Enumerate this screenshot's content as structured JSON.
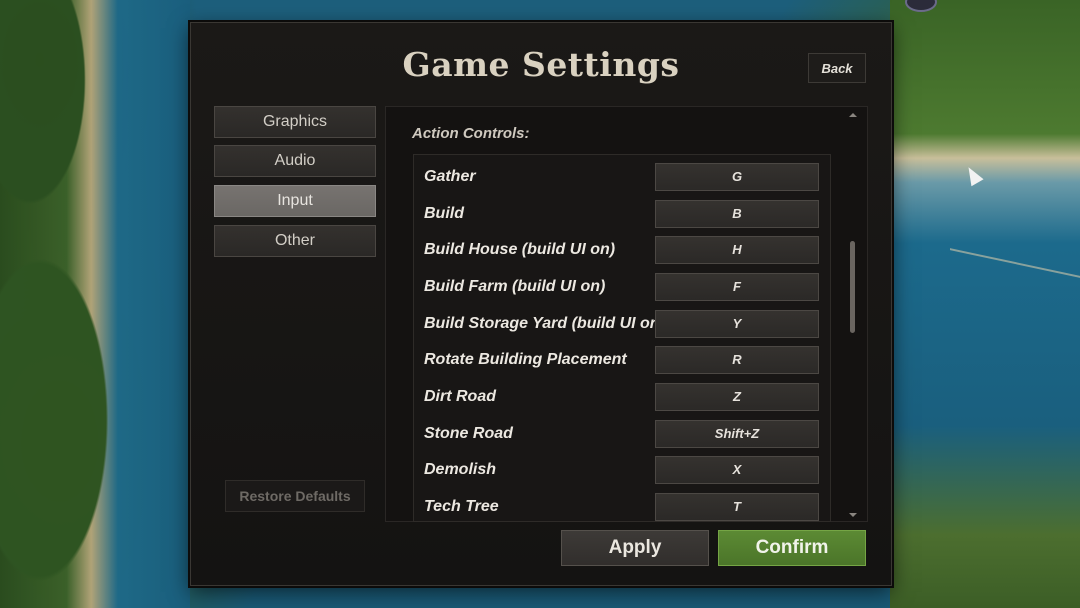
{
  "window": {
    "title": "Game Settings",
    "back_label": "Back"
  },
  "sidebar": {
    "items": [
      {
        "label": "Graphics",
        "active": false
      },
      {
        "label": "Audio",
        "active": false
      },
      {
        "label": "Input",
        "active": true
      },
      {
        "label": "Other",
        "active": false
      }
    ],
    "restore_label": "Restore Defaults"
  },
  "content": {
    "section_title": "Action Controls:",
    "bindings": [
      {
        "action": "Gather",
        "key": "G"
      },
      {
        "action": "Build",
        "key": "B"
      },
      {
        "action": "Build House (build UI on)",
        "key": "H"
      },
      {
        "action": "Build Farm (build UI on)",
        "key": "F"
      },
      {
        "action": "Build Storage Yard (build UI on)",
        "key": "Y"
      },
      {
        "action": "Rotate Building Placement",
        "key": "R"
      },
      {
        "action": "Dirt Road",
        "key": "Z"
      },
      {
        "action": "Stone Road",
        "key": "Shift+Z"
      },
      {
        "action": "Demolish",
        "key": "X"
      },
      {
        "action": "Tech Tree",
        "key": "T"
      }
    ]
  },
  "footer": {
    "apply_label": "Apply",
    "confirm_label": "Confirm"
  },
  "colors": {
    "confirm": "#4f7a2c",
    "active_tab": "#716e6b"
  },
  "icons": {
    "scroll_up": "chevron-up-icon",
    "scroll_down": "chevron-down-icon",
    "cursor": "mouse-cursor-icon"
  }
}
